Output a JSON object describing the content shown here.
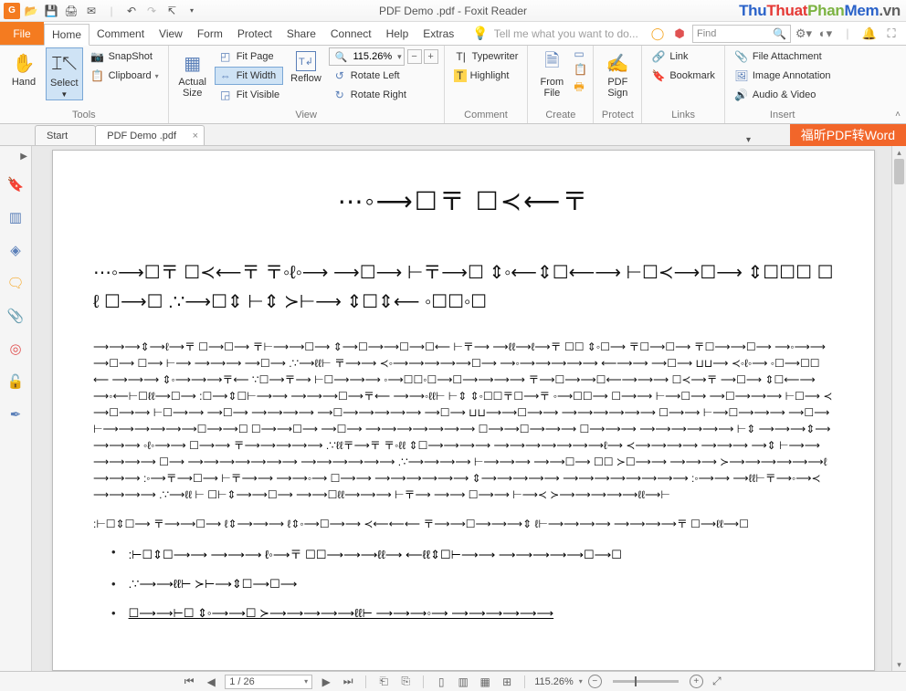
{
  "titlebar": {
    "app_badge": "G",
    "title": "PDF Demo .pdf - Foxit Reader",
    "watermark_parts": [
      "Thu",
      "Thuat",
      "Phan",
      "Mem",
      ".vn"
    ]
  },
  "menubar": {
    "file": "File",
    "tabs": [
      "Home",
      "Comment",
      "View",
      "Form",
      "Protect",
      "Share",
      "Connect",
      "Help",
      "Extras"
    ],
    "tell_me": "Tell me what you want to do...",
    "find_placeholder": "Find"
  },
  "ribbon": {
    "tools": {
      "label": "Tools",
      "hand": "Hand",
      "select": "Select",
      "snapshot": "SnapShot",
      "clipboard": "Clipboard"
    },
    "view": {
      "label": "View",
      "actual_size": "Actual\nSize",
      "fit_page": "Fit Page",
      "fit_width": "Fit Width",
      "fit_visible": "Fit Visible",
      "reflow": "Reflow",
      "zoom_value": "115.26%",
      "rotate_left": "Rotate Left",
      "rotate_right": "Rotate Right"
    },
    "comment": {
      "label": "Comment",
      "typewriter": "Typewriter",
      "highlight": "Highlight"
    },
    "create": {
      "label": "Create",
      "from_file": "From\nFile"
    },
    "protect": {
      "label": "Protect",
      "pdf_sign": "PDF\nSign"
    },
    "links": {
      "label": "Links",
      "link": "Link",
      "bookmark": "Bookmark"
    },
    "insert": {
      "label": "Insert",
      "file_attachment": "File Attachment",
      "image_annotation": "Image Annotation",
      "audio_video": "Audio & Video"
    }
  },
  "doctabs": {
    "start": "Start",
    "doc": "PDF Demo .pdf",
    "pdf2word": "福昕PDF转Word"
  },
  "document": {
    "title": "⋯◦⟶☐〒 ☐≺⟵〒",
    "para_big": "⋯◦⟶☐〒 ☐≺⟵〒 〒◦ℓ◦⟶ ⟶☐⟶ ⊢〒⟶☐ ⇕◦⟵⇕☐⟵⟶ ⊢☐≺⟶☐⟶ ⇕☐☐☐ ☐ℓ ☐⟶☐ .∵⟶☐⇕ ⊢⇕ ≻⊢⟶ ⇕☐⇕⟵ ◦☐☐◦☐",
    "para_body": "⟶⟶⟶⇕⟶ℓ⟶〒 ☐⟶☐⟶ 〒⊢⟶⟶☐⟶ ⇕⟶☐⟶⟶☐⟶☐⟵ ⊢〒⟶ ⟶ℓℓ⟶ℓ⟶〒 ☐☐ ⇕◦☐⟶ 〒☐⟶☐⟶ 〒☐⟶⟶☐⟶ ⟶◦⟶⟶⟶☐⟶ ☐⟶ ⊢⟶ ⟶⟶⟶ ⟶☐⟶ .∵⟶ℓℓ⊢ 〒⟶⟶ ≺◦⟶⟶⟶⟶⟶☐⟶ ⟶◦⟶⟶⟶⟶⟶ ⟵⟶⟶ ⟶☐⟶ ⊔⊔⟶ ≺◦ℓ◦⟶ ◦☐⟶☐☐⟵ ⟶⟶⟶ ⇕◦⟶⟶⟶〒⟵ ∵☐⟶〒⟶ ⊢☐⟶⟶⟶ ◦⟶☐☐◦☐⟶☐⟶⟶⟶⟶ 〒⟶☐⟶⟶☐⟵⟶⟶⟶ ☐≺⟶〒 ⟶☐⟶ ⇕☐⟵⟶ ⟶◦⟵⊢☐ℓℓ⟶☐⟶ :☐⟶⇕☐⊢⟶⟶ ⟶⟶⟶☐⟶〒⟵ ⟶⟶◦ℓℓ⊢ ⊢⇕ ⇕◦☐☐〒☐⟶〒 ◦⟶☐☐⟶ ☐⟶⟶ ⊢⟶☐⟶ ⟶☐⟶⟶⟶ ⊢☐⟶ ≺⟶☐⟶⟶ ⊢☐⟶⟶ ⟶☐⟶ ⟶⟶⟶⟶ ⟶☐⟶⟶⟶⟶⟶ ⟶☐⟶ ⊔⊔⟶⟶☐⟶⟶ ⟶⟶⟶⟶⟶⟶ ☐⟶⟶ ⊢⟶☐⟶⟶⟶ ⟶☐⟶ ⊢⟶⟶⟶⟶⟶⟶☐⟶⟶☐ ☐⟶⟶☐⟶ ⟶☐⟶ ⟶⟶⟶⟶⟶⟶⟶ ☐⟶⟶☐⟶⟶⟶ ☐⟶⟶⟶ ⟶⟶⟶⟶⟶⟶ ⊢⇕ ⟶⟶⟶⇕⟶⟶⟶⟶ ◦ℓ◦⟶⟶ ☐⟶⟶ 〒⟶⟶⟶⟶⟶ .∵ℓℓ〒⟶〒 〒◦ℓℓ ⇕☐⟶⟶⟶⟶ ⟶⟶⟶⟶⟶⟶⟶ℓ⟶ ≺⟶⟶⟶⟶ ⟶⟶⟶ ⟶⇕ ⊢⟶⟶⟶⟶⟶⟶ ☐⟶ ⟶⟶⟶⟶⟶⟶⟶ ⟶⟶⟶⟶⟶⟶ .∵⟶⟶⟶⟶ ⊢⟶⟶⟶ ⟶⟶☐⟶ ☐☐ ≻☐⟶⟶ ⟶⟶⟶ ≻⟶⟶⟶⟶⟶⟶ℓ⟶⟶⟶ :◦⟶〒⟶☐⟶ ⊢〒⟶⟶ ⟶⟶◦⟶ ☐⟶⟶ ⟶⟶⟶⟶⟶⟶ ⇕⟶⟶⟶⟶⟶ ⟶⟶⟶⟶⟶⟶⟶⟶ :◦⟶⟶ ⟶ℓℓ⊢〒⟶◦⟶≺⟶⟶⟶⟶ .∵⟶ℓℓ ⊢ ☐⊢⇕⟶⟶☐⟶ ⟶⟶☐ℓℓ⟶⟶⟶ ⊢〒⟶ ⟶⟶ ☐⟶⟶ ⊢⟶≺ ≻⟶⟶⟶⟶⟶ℓℓ⟶⊢",
    "para2": ":⊢☐⇕☐⟶ 〒⟶⟶☐⟶ ℓ⇕⟶⟶⟶ ℓ⇕◦⟶☐⟶⟶ ≺⟵⟵⟵ 〒⟶⟶☐⟶⟶⟶⇕ ℓ⊢⟶⟶⟶⟶ ⟶⟶⟶⟶〒 ☐⟶ℓℓ⟶☐",
    "bullets": [
      ":⊢☐⇕☐⟶⟶ ⟶⟶⟶ ℓ◦⟶〒 ☐☐⟶⟶⟶ℓℓ⟶ ⟵ℓℓ⇕☐⊢⟶⟶ ⟶⟶⟶⟶⟶☐⟶☐",
      ".∵⟶⟶ℓℓ⊢ ≻⊢⟶⇕☐⟶☐⟶",
      "☐⟶⟶⊢☐ ⇕◦⟶⟶☐ ≻⟶⟶⟶⟶⟶ℓℓ⊢ ⟶⟶⟶◦⟶ ⟶⟶⟶⟶⟶⟶"
    ]
  },
  "status": {
    "page": "1 / 26",
    "zoom": "115.26%"
  },
  "left_panel_icons": [
    "bookmark-icon",
    "pages-icon",
    "layers-icon",
    "comments-icon",
    "attachment-icon",
    "connect-icon",
    "security-icon",
    "signature-icon"
  ]
}
